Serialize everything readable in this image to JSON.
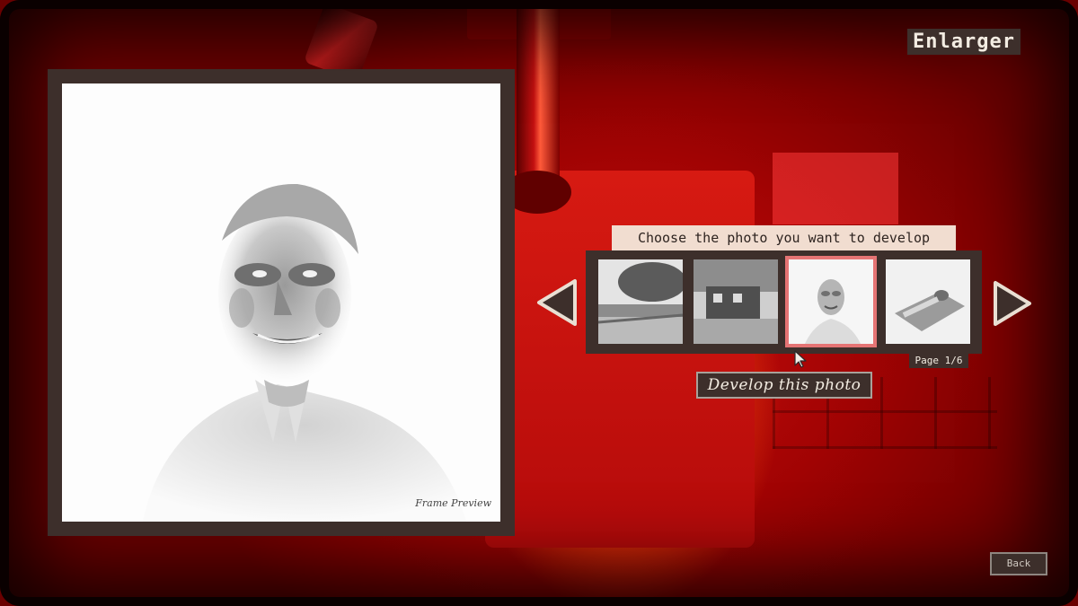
{
  "screen": {
    "title": "Enlarger"
  },
  "preview": {
    "caption": "Frame Preview"
  },
  "selector": {
    "prompt": "Choose the photo you want to develop",
    "page_label": "Page 1/6",
    "prev_icon": "triangle-left-icon",
    "next_icon": "triangle-right-icon",
    "thumbnails": [
      {
        "subject": "tree-landscape",
        "selected": false
      },
      {
        "subject": "house",
        "selected": false
      },
      {
        "subject": "woman-portrait",
        "selected": true
      },
      {
        "subject": "figure-on-bed",
        "selected": false
      }
    ]
  },
  "actions": {
    "develop_label": "Develop this photo",
    "back_label": "Back"
  },
  "colors": {
    "panel": "#3d2f2b",
    "selected_outline": "#e57474",
    "prompt_bg": "#f1ddd0"
  }
}
